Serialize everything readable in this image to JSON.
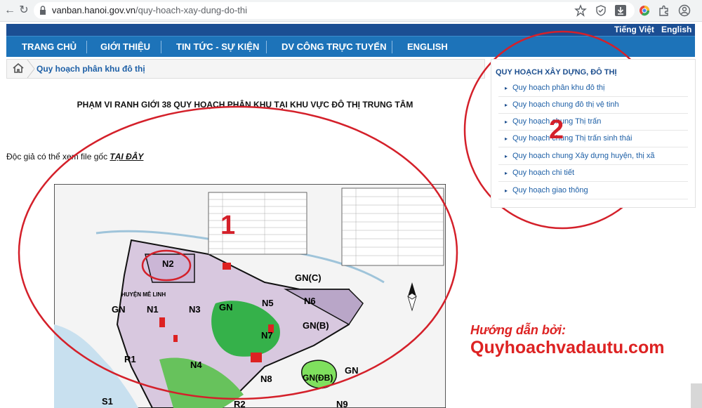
{
  "browser": {
    "url_host": "vanban.hanoi.gov.vn",
    "url_path": "/quy-hoach-xay-dung-do-thi"
  },
  "lang_bar": {
    "vietnamese": "Tiếng Việt",
    "english": "English"
  },
  "nav": [
    {
      "label": "TRANG CHỦ"
    },
    {
      "label": "GIỚI THIỆU"
    },
    {
      "label": "TIN TỨC - SỰ KIỆN"
    },
    {
      "label": "DV CÔNG TRỰC TUYẾN"
    },
    {
      "label": "ENGLISH"
    }
  ],
  "breadcrumb": {
    "label": "Quy hoạch phân khu đô thị"
  },
  "article": {
    "heading": "PHẠM VI RANH GIỚI 38 QUY HOẠCH PHÂN KHU TẠI KHU VỰC ĐÔ THỊ TRUNG TÂM",
    "intro": "Độc giả có thể xem file gốc",
    "intro_link": "TẠI ĐÂY"
  },
  "map": {
    "zones": [
      "N2",
      "GN",
      "N1",
      "N3",
      "GN",
      "N5",
      "N6",
      "GN(C)",
      "GN(B)",
      "N7",
      "R1",
      "N4",
      "N8",
      "GN(ĐB)",
      "GN",
      "S1",
      "R2",
      "N9"
    ],
    "small_label": "HUYỆN MÊ LINH"
  },
  "sidebar": {
    "title": "QUY HOẠCH XÂY DỰNG, ĐÔ THỊ",
    "items": [
      {
        "label": "Quy hoạch phân khu đô thị"
      },
      {
        "label": "Quy hoạch chung đô thị vệ tinh"
      },
      {
        "label": "Quy hoạch chung Thị trấn"
      },
      {
        "label": "Quy hoạch chung Thị trấn sinh thái"
      },
      {
        "label": "Quy hoạch chung Xây dựng huyện, thị xã"
      },
      {
        "label": "Quy hoạch chi tiết"
      },
      {
        "label": "Quy hoạch giao thông"
      }
    ]
  },
  "annotations": {
    "marker_1": "1",
    "marker_2": "2"
  },
  "watermark": {
    "guide_line": "Hướng dẫn bởi:",
    "site": "Quyhoachvadautu.com"
  },
  "colors": {
    "nav_bg": "#1d73b9",
    "lang_bar_bg": "#1b4e93",
    "annotation_red": "#d4202a"
  }
}
